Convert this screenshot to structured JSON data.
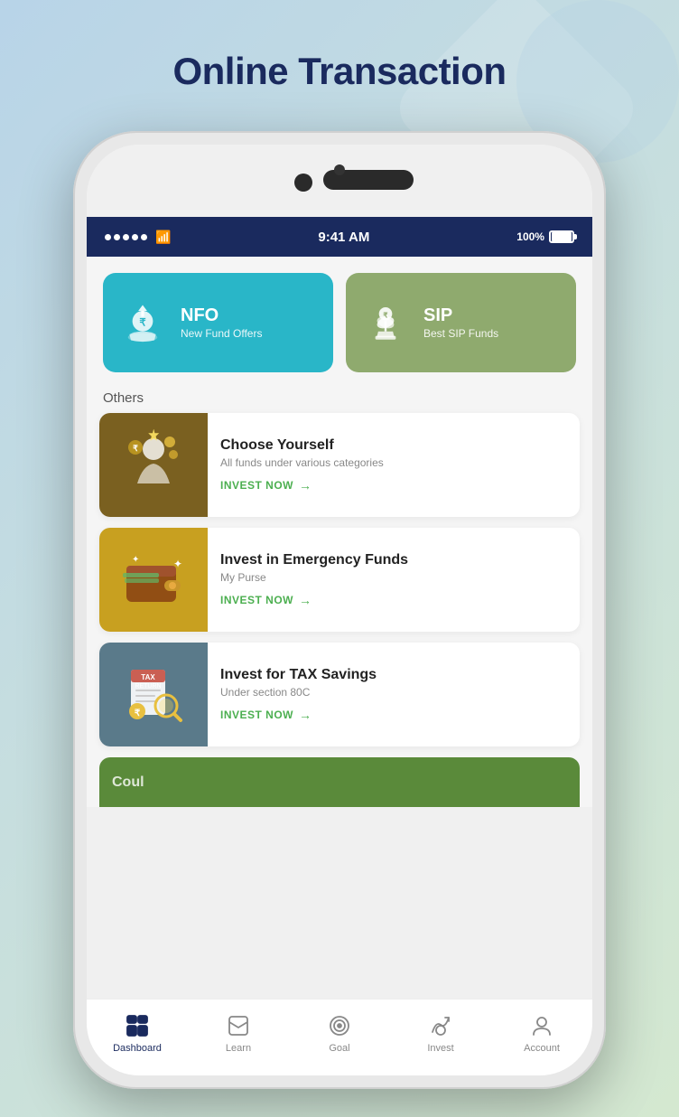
{
  "page": {
    "title": "Online Transaction",
    "background_gradient": "linear-gradient(135deg, #b8d4e8, #c5dde0, #d4e8d0)"
  },
  "status_bar": {
    "time": "9:41 AM",
    "battery": "100%",
    "signal": "●●●●●",
    "wifi": "wifi"
  },
  "top_cards": [
    {
      "id": "nfo",
      "title": "NFO",
      "subtitle": "New Fund Offers",
      "bg_color": "#29b6c8",
      "icon": "nfo-icon"
    },
    {
      "id": "sip",
      "title": "SIP",
      "subtitle": "Best SIP Funds",
      "bg_color": "#8faa6e",
      "icon": "sip-icon"
    }
  ],
  "others_label": "Others",
  "list_items": [
    {
      "id": "choose-yourself",
      "title": "Choose Yourself",
      "subtitle": "All funds under various categories",
      "cta": "INVEST NOW",
      "img_color": "#7a6020",
      "icon": "person-icon"
    },
    {
      "id": "emergency-funds",
      "title": "Invest in Emergency Funds",
      "subtitle": "My Purse",
      "cta": "INVEST NOW",
      "img_color": "#c8a020",
      "icon": "wallet-icon"
    },
    {
      "id": "tax-savings",
      "title": "Invest for TAX Savings",
      "subtitle": "Under section 80C",
      "cta": "INVEST NOW",
      "img_color": "#5a7a8a",
      "icon": "tax-icon"
    }
  ],
  "bottom_nav": [
    {
      "id": "dashboard",
      "label": "Dashboard",
      "active": true,
      "icon": "dashboard-icon"
    },
    {
      "id": "learn",
      "label": "Learn",
      "active": false,
      "icon": "learn-icon"
    },
    {
      "id": "goal",
      "label": "Goal",
      "active": false,
      "icon": "goal-icon"
    },
    {
      "id": "invest",
      "label": "Invest",
      "active": false,
      "icon": "invest-icon"
    },
    {
      "id": "account",
      "label": "Account",
      "active": false,
      "icon": "account-icon"
    }
  ],
  "partial_item": {
    "text": "Coul",
    "bg_color": "#5a8a3a"
  }
}
